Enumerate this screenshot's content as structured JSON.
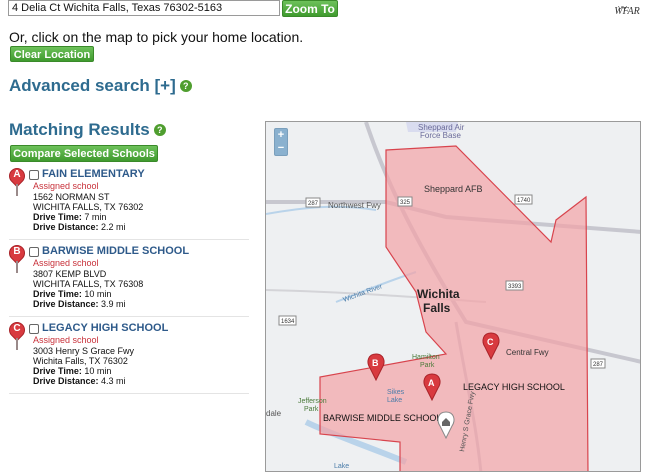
{
  "search": {
    "value": "4 Delia Ct Wichita Falls, Texas 76302-5163",
    "zoom_label": "Zoom To"
  },
  "logo": {
    "text": "WFAR"
  },
  "instruction": "Or, click on the map to pick your home location.",
  "clear_label": "Clear Location",
  "advanced_search": "Advanced search [+]",
  "results_title": "Matching Results",
  "compare_label": "Compare Selected Schools",
  "schools": [
    {
      "pin": "A",
      "name": "FAIN ELEMENTARY",
      "status": "Assigned school",
      "address1": "1562 NORMAN ST",
      "address2": "WICHITA FALLS, TX 76302",
      "drive_time_label": "Drive Time:",
      "drive_time": "7 min",
      "drive_distance_label": "Drive Distance:",
      "drive_distance": "2.2 mi"
    },
    {
      "pin": "B",
      "name": "BARWISE MIDDLE SCHOOL",
      "status": "Assigned school",
      "address1": "3807 KEMP BLVD",
      "address2": "WICHITA FALLS, TX 76308",
      "drive_time_label": "Drive Time:",
      "drive_time": "10 min",
      "drive_distance_label": "Drive Distance:",
      "drive_distance": "3.9 mi"
    },
    {
      "pin": "C",
      "name": "LEGACY HIGH SCHOOL",
      "status": "Assigned school",
      "address1": "3003 Henry S Grace Fwy",
      "address2": "Wichita Falls, TX 76302",
      "drive_time_label": "Drive Time:",
      "drive_time": "10 min",
      "drive_distance_label": "Drive Distance:",
      "drive_distance": "4.3 mi"
    }
  ],
  "map": {
    "zoom_in": "+",
    "zoom_out": "−",
    "labels": {
      "sheppard_afb": "Sheppard AFB",
      "sheppard_air": "Sheppard Air",
      "force_base": "Force Base",
      "northwest_fwy": "Northwest Fwy",
      "wichita": "Wichita",
      "falls": "Falls",
      "wichita_river": "Wichita River",
      "central_fwy": "Central Fwy",
      "hamilton": "Hamilton",
      "park": "Park",
      "sikes": "Sikes",
      "lake": "Lake",
      "jefferson": "Jefferson",
      "park2": "Park",
      "dale": "dale",
      "lake2": "Lake",
      "henry_grace": "Henry S Grace Fwy",
      "legacy": "LEGACY HIGH SCHOOL",
      "barwise": "BARWISE MIDDLE SCHOOL",
      "hwy_287a": "287",
      "hwy_325": "325",
      "hwy_1740": "1740",
      "hwy_3393": "3393",
      "hwy_1634": "1634",
      "hwy_287b": "287",
      "pin_a": "A",
      "pin_b": "B",
      "pin_c": "C"
    }
  },
  "colors": {
    "accent_green": "#4f9e2f",
    "heading_blue": "#2e6b8f",
    "zone_fill": "#f3a2a6",
    "zone_stroke": "#d8444d",
    "pin_red": "#d83a3f"
  }
}
